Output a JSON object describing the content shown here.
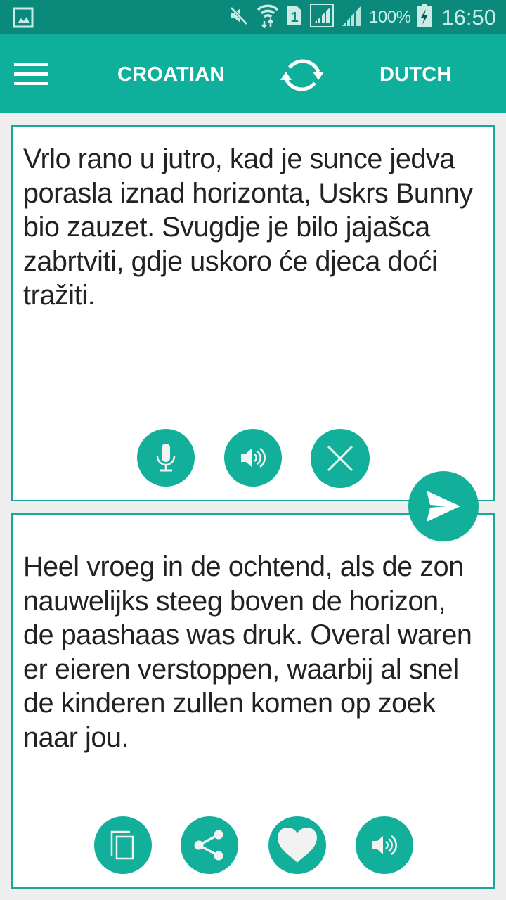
{
  "status_bar": {
    "battery_percent": "100%",
    "time": "16:50",
    "icons": [
      "gallery-notification-icon",
      "mute-icon",
      "wifi-data-icon",
      "sim-1-icon",
      "signal-sim1-icon",
      "signal-sim2-icon",
      "battery-charging-icon"
    ]
  },
  "app_bar": {
    "menu_icon": "hamburger-menu-icon",
    "source_language": "CROATIAN",
    "swap_icon": "swap-languages-icon",
    "target_language": "DUTCH"
  },
  "source_panel": {
    "text": "Vrlo rano u jutro, kad je sunce jedva porasla iznad horizonta, Uskrs Bunny bio zauzet. Svugdje je bilo jajašca zabrtviti, gdje uskoro će djeca doći tražiti.",
    "actions": [
      {
        "name": "microphone-button",
        "icon": "microphone-icon"
      },
      {
        "name": "speak-source-button",
        "icon": "speaker-icon"
      },
      {
        "name": "clear-button",
        "icon": "close-icon"
      }
    ]
  },
  "translate_button": {
    "icon": "send-icon"
  },
  "target_panel": {
    "text": "Heel vroeg in de ochtend, als de zon nauwelijks steeg boven de horizon, de paashaas was druk. Overal waren er eieren verstoppen, waarbij al snel de kinderen zullen komen op zoek naar jou.",
    "actions": [
      {
        "name": "copy-button",
        "icon": "copy-icon"
      },
      {
        "name": "share-button",
        "icon": "share-icon"
      },
      {
        "name": "favorite-button",
        "icon": "heart-icon"
      },
      {
        "name": "speak-target-button",
        "icon": "speaker-icon"
      }
    ]
  },
  "colors": {
    "status_bar": "#0b8a7c",
    "accent": "#12b09b",
    "panel_border": "#17a898",
    "background": "#eeeeee",
    "text": "#222222"
  }
}
